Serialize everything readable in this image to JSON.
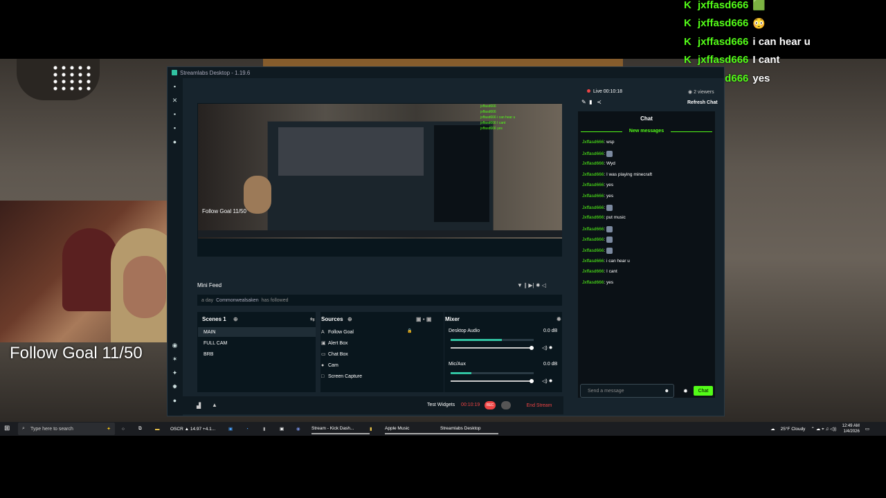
{
  "overlay_chat": [
    {
      "user": "jxffasd666",
      "msg": "🟩"
    },
    {
      "user": "jxffasd666",
      "msg": "😳"
    },
    {
      "user": "jxffasd666",
      "msg": "i can hear u"
    },
    {
      "user": "jxffasd666",
      "msg": "I cant"
    },
    {
      "user": "jxffasd666",
      "msg": "yes"
    }
  ],
  "overlay_badge": "K",
  "follow_goal": "Follow Goal 11/50",
  "window": {
    "title": "Streamlabs Desktop - 1.19.6"
  },
  "preview": {
    "follow_goal": "Follow Goal 11/50",
    "chat_lines": [
      "jxffasd666",
      "jxffasd666",
      "jxffasd666 i can hear u",
      "jxffasd666 I cant",
      "jxffasd666 yes"
    ]
  },
  "minifeed": {
    "title": "Mini Feed",
    "time": "a day",
    "user": "Commonwealsaken",
    "action": "has followed"
  },
  "scenes": {
    "title": "Scenes 1",
    "items": [
      "MAIN",
      "FULL CAM",
      "BRB"
    ]
  },
  "sources": {
    "title": "Sources",
    "items": [
      {
        "icon": "A",
        "label": "Follow Goal"
      },
      {
        "icon": "▣",
        "label": "Alert Box"
      },
      {
        "icon": "▭",
        "label": "Chat Box"
      },
      {
        "icon": "●",
        "label": "Cam"
      },
      {
        "icon": "□",
        "label": "Screen Capture"
      }
    ]
  },
  "mixer": {
    "title": "Mixer",
    "channels": [
      {
        "name": "Desktop Audio",
        "db": "0.0 dB",
        "level": 0.62
      },
      {
        "name": "Mic/Aux",
        "db": "0.0 dB",
        "level": 0.25
      }
    ]
  },
  "bottom": {
    "test_widgets": "Test Widgets",
    "time": "00:10:19",
    "rec": "REC",
    "end_stream": "End Stream"
  },
  "chat": {
    "live": "Live 00:10:18",
    "viewers": "2 viewers",
    "refresh": "Refresh Chat",
    "title": "Chat",
    "new_messages": "New messages",
    "messages": [
      {
        "user": "Jxffasd666",
        "text": "wsp",
        "emote": false
      },
      {
        "user": "Jxffasd666",
        "text": "",
        "emote": true
      },
      {
        "user": "Jxffasd666",
        "text": "Wyd",
        "emote": false
      },
      {
        "user": "Jxffasd666",
        "text": "I was playing minecraft",
        "emote": false
      },
      {
        "user": "Jxffasd666",
        "text": "yes",
        "emote": false
      },
      {
        "user": "Jxffasd666",
        "text": "yes",
        "emote": false
      },
      {
        "user": "Jxffasd666",
        "text": "",
        "emote": true
      },
      {
        "user": "Jxffasd666",
        "text": "put music",
        "emote": false
      },
      {
        "user": "Jxffasd666",
        "text": "",
        "emote": true
      },
      {
        "user": "Jxffasd666",
        "text": "",
        "emote": true
      },
      {
        "user": "Jxffasd666",
        "text": "",
        "emote": true
      },
      {
        "user": "Jxffasd666",
        "text": "i can hear u",
        "emote": false
      },
      {
        "user": "Jxffasd666",
        "text": "I cant",
        "emote": false
      },
      {
        "user": "Jxffasd666",
        "text": "yes",
        "emote": false
      }
    ],
    "input_placeholder": "Send a message",
    "send": "Chat"
  },
  "taskbar": {
    "search": "Type here to search",
    "items": [
      {
        "label": "OSCR ▲ 14.97 +4.1...",
        "on": false
      },
      {
        "label": "Stream - Kick Dash...",
        "on": true
      },
      {
        "label": "Apple Music",
        "on": true
      },
      {
        "label": "Streamlabs Desktop",
        "on": true
      }
    ],
    "weather": "25°F  Cloudy",
    "time": "12:49 AM",
    "date": "1/4/2026"
  }
}
